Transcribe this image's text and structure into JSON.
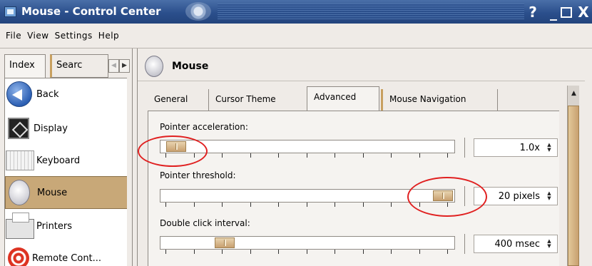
{
  "window": {
    "title": "Mouse - Control Center",
    "buttons": {
      "help": "?",
      "minimize": "_",
      "close": "X"
    }
  },
  "menu": [
    "File",
    "View",
    "Settings",
    "Help"
  ],
  "sidebar": {
    "tabs": [
      "Index",
      "Searc"
    ],
    "items": [
      {
        "label": "Back",
        "icon": "back-arrow-icon"
      },
      {
        "label": "Display",
        "icon": "display-icon"
      },
      {
        "label": "Keyboard",
        "icon": "keyboard-icon"
      },
      {
        "label": "Mouse",
        "icon": "mouse-icon",
        "selected": true
      },
      {
        "label": "Printers",
        "icon": "printer-icon"
      },
      {
        "label": "Remote Cont...",
        "icon": "remote-icon"
      }
    ]
  },
  "main": {
    "header": "Mouse",
    "tabs": [
      "General",
      "Cursor Theme",
      "Advanced",
      "Mouse Navigation"
    ],
    "active_tab": "Advanced",
    "settings": [
      {
        "label": "Pointer acceleration:",
        "value": "1.0x",
        "slider_level": 0.02
      },
      {
        "label": "Pointer threshold:",
        "value": "20 pixels",
        "slider_level": 1.0
      },
      {
        "label": "Double click interval:",
        "value": "400 msec",
        "slider_level": 0.2
      }
    ]
  },
  "colors": {
    "titlebar": "#2b4f8c",
    "selection": "#c8a878",
    "annotation": "#e02020"
  }
}
